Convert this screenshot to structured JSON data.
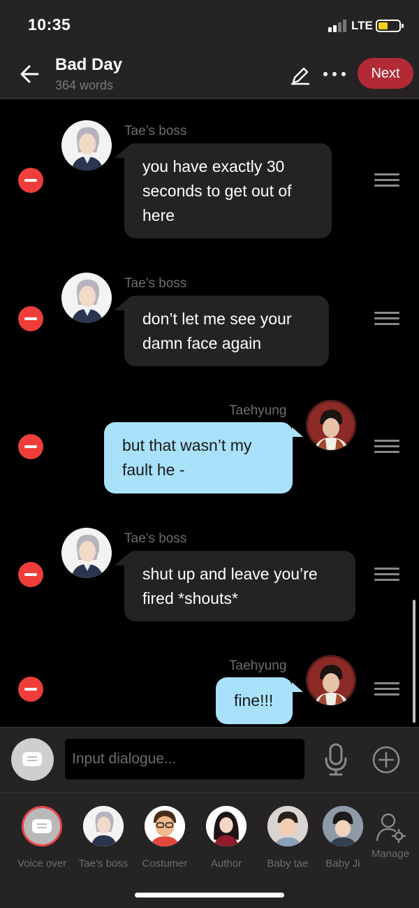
{
  "status_bar": {
    "time": "10:35",
    "network": "LTE",
    "icons": [
      "signal-icon",
      "battery-icon"
    ]
  },
  "header": {
    "title": "Bad Day",
    "word_count": "364 words",
    "next_label": "Next",
    "icons": [
      "back-arrow-icon",
      "pencil-icon",
      "more-icon"
    ]
  },
  "messages": [
    {
      "speaker": "Tae’s boss",
      "side": "left",
      "line1": "you have exactly 30",
      "line2": "seconds to get out of",
      "line3": "here"
    },
    {
      "speaker": "Tae’s boss",
      "side": "left",
      "line1": "don’t let me see your",
      "line2": "damn face again"
    },
    {
      "speaker": "Taehyung",
      "side": "right",
      "line1": "but that wasn’t my",
      "line2": "fault he -"
    },
    {
      "speaker": "Tae’s boss",
      "side": "left",
      "line1": "shut up and leave you’re",
      "line2": "fired *shouts*"
    },
    {
      "speaker": "Taehyung",
      "side": "right",
      "line1": "fine!!!"
    }
  ],
  "input": {
    "placeholder": "Input dialogue...",
    "icons": [
      "chat-bubble-icon",
      "microphone-icon",
      "plus-icon"
    ]
  },
  "characters": [
    {
      "label": "Voice over"
    },
    {
      "label": "Tae’s boss"
    },
    {
      "label": "Costumer"
    },
    {
      "label": "Author"
    },
    {
      "label": "Baby tae"
    },
    {
      "label": "Baby Ji"
    }
  ],
  "manage_label": "Manage",
  "colors": {
    "accent": "#b22a35",
    "remove": "#ef3d3b",
    "bubble_right": "#a9e1fb",
    "bubble_left": "#242222",
    "bar_bg": "#252323"
  }
}
